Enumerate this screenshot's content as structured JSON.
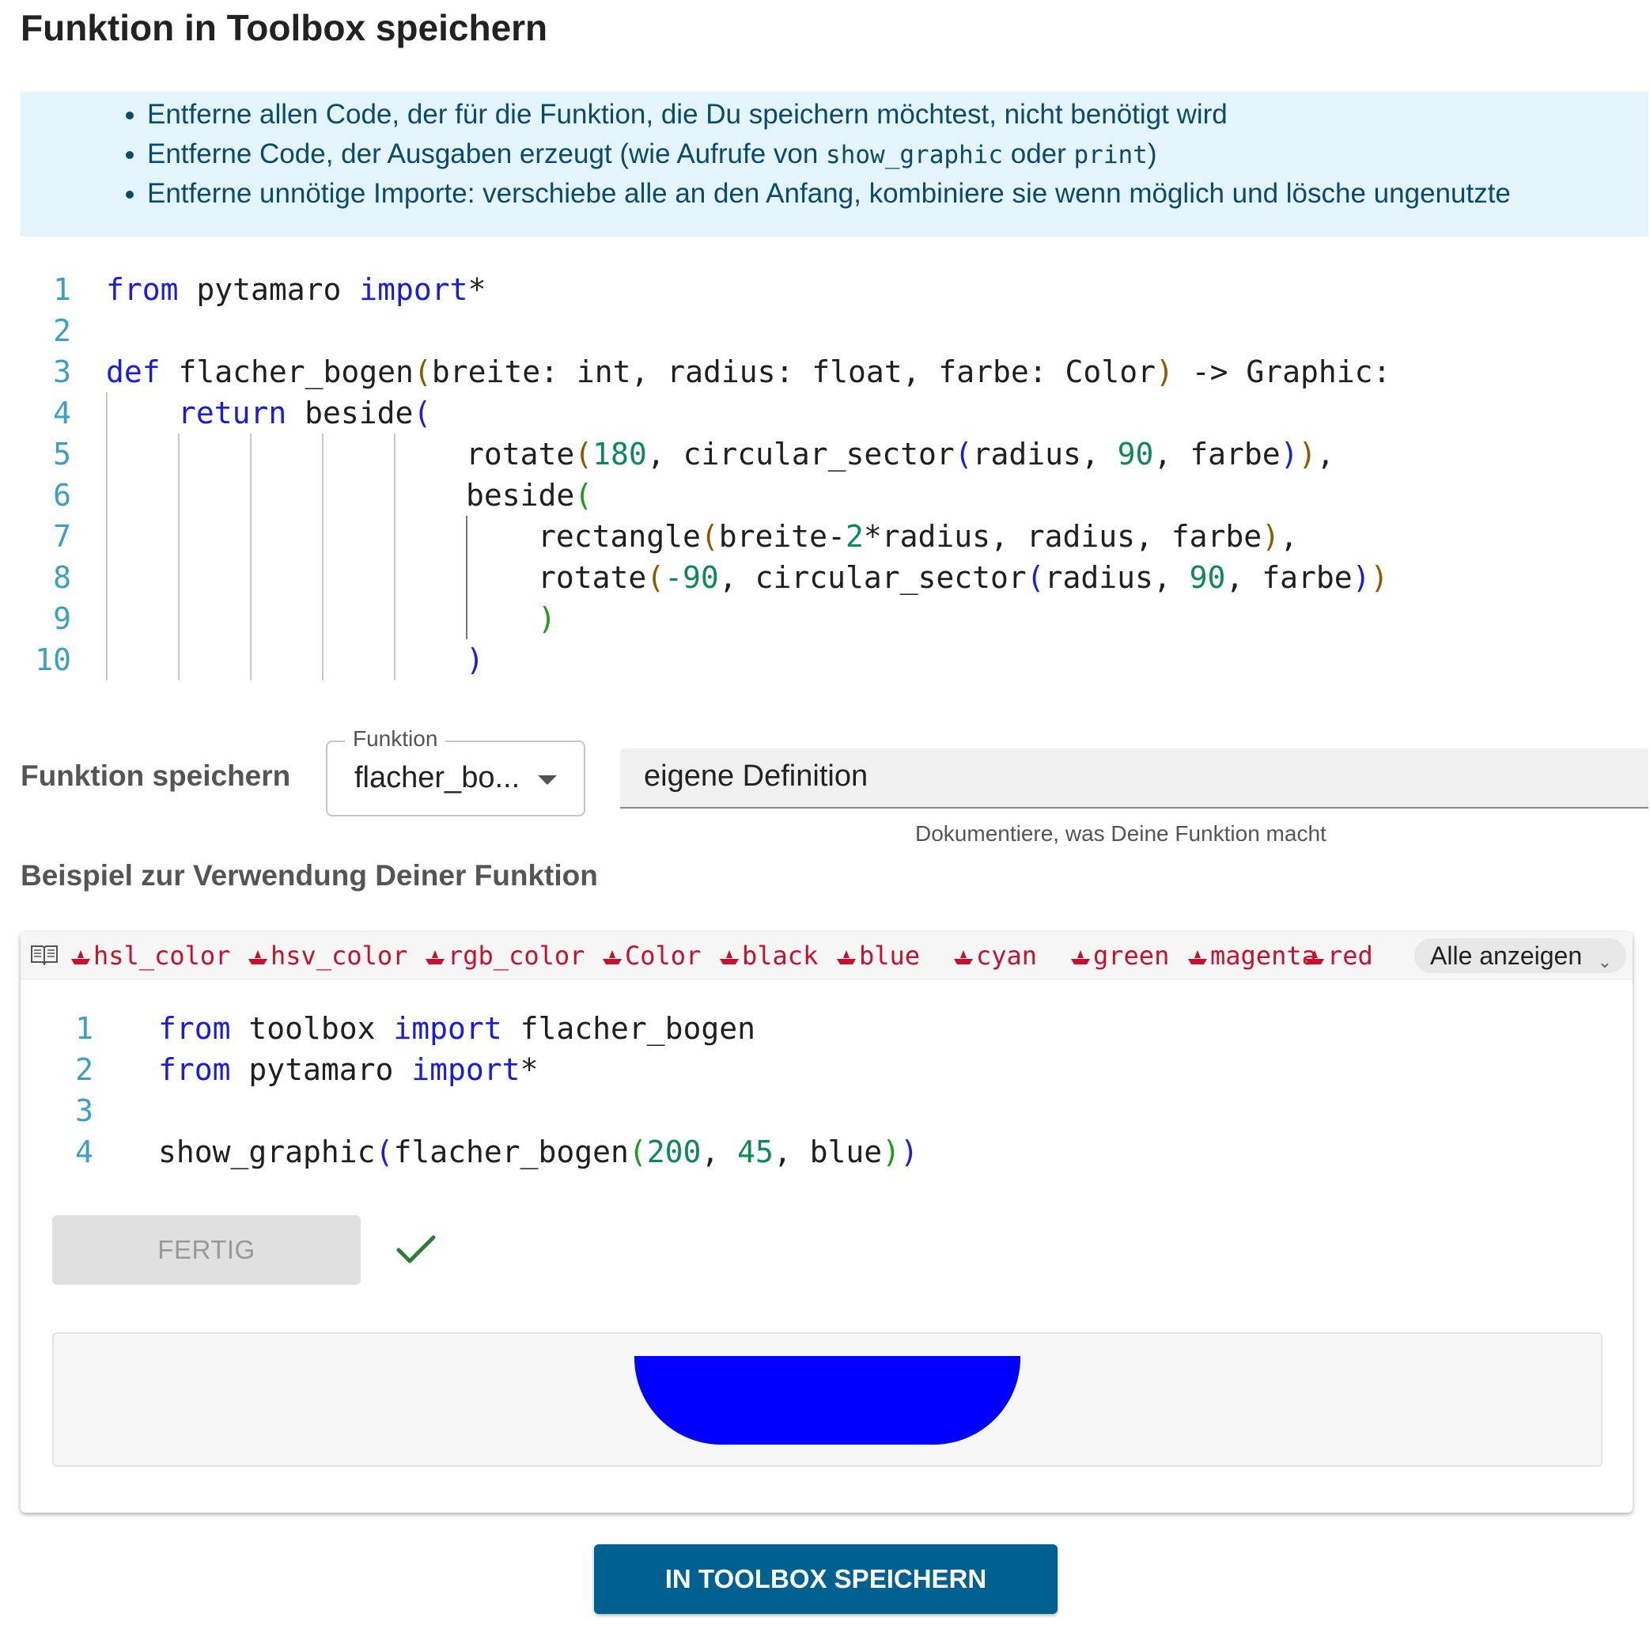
{
  "title": "Funktion in Toolbox speichern",
  "hints": [
    {
      "text": "Entferne allen Code, der für die Funktion, die Du speichern möchtest, nicht benötigt wird"
    },
    {
      "before": "Entferne Code, der Ausgaben erzeugt (wie Aufrufe von ",
      "code1": "show_graphic",
      "middle": " oder ",
      "code2": "print",
      "after": ")"
    },
    {
      "text": "Entferne unnötige Importe: verschiebe alle an den Anfang, kombiniere sie wenn möglich und lösche ungenutzte"
    }
  ],
  "main_code": {
    "line_numbers": [
      "1",
      "2",
      "3",
      "4",
      "5",
      "6",
      "7",
      "8",
      "9",
      "10"
    ],
    "lines": [
      "from pytamaro import*",
      "",
      "def flacher_bogen(breite: int, radius: float, farbe: Color) -> Graphic:",
      "    return beside(",
      "                rotate(180, circular_sector(radius, 90, farbe)),",
      "                beside(",
      "                    rectangle(breite-2*radius, radius, farbe),",
      "                    rotate(-90, circular_sector(radius, 90, farbe))",
      "                    )",
      "                )"
    ]
  },
  "save_section": {
    "label": "Funktion speichern",
    "select_legend": "Funktion",
    "select_value": "flacher_bo...",
    "definition_value": "eigene Definition",
    "definition_helper": "Dokumentiere, was Deine Funktion macht"
  },
  "example_label": "Beispiel zur Verwendung Deiner Funktion",
  "chips": [
    "hsl_color",
    "hsv_color",
    "rgb_color",
    "Color",
    "black",
    "blue",
    "cyan",
    "green",
    "magenta",
    "red"
  ],
  "show_all_label": "Alle anzeigen",
  "example_code": {
    "line_numbers": [
      "1",
      "2",
      "3",
      "4"
    ],
    "lines": [
      "from toolbox import flacher_bogen",
      "from pytamaro import*",
      "",
      "show_graphic(flacher_bogen(200, 45, blue))"
    ]
  },
  "fertig_label": "FERTIG",
  "status_icon": "check-icon",
  "graphic_color": "#0000ff",
  "accent_color": "#00608f",
  "save_button_label": "IN TOOLBOX SPEICHERN"
}
